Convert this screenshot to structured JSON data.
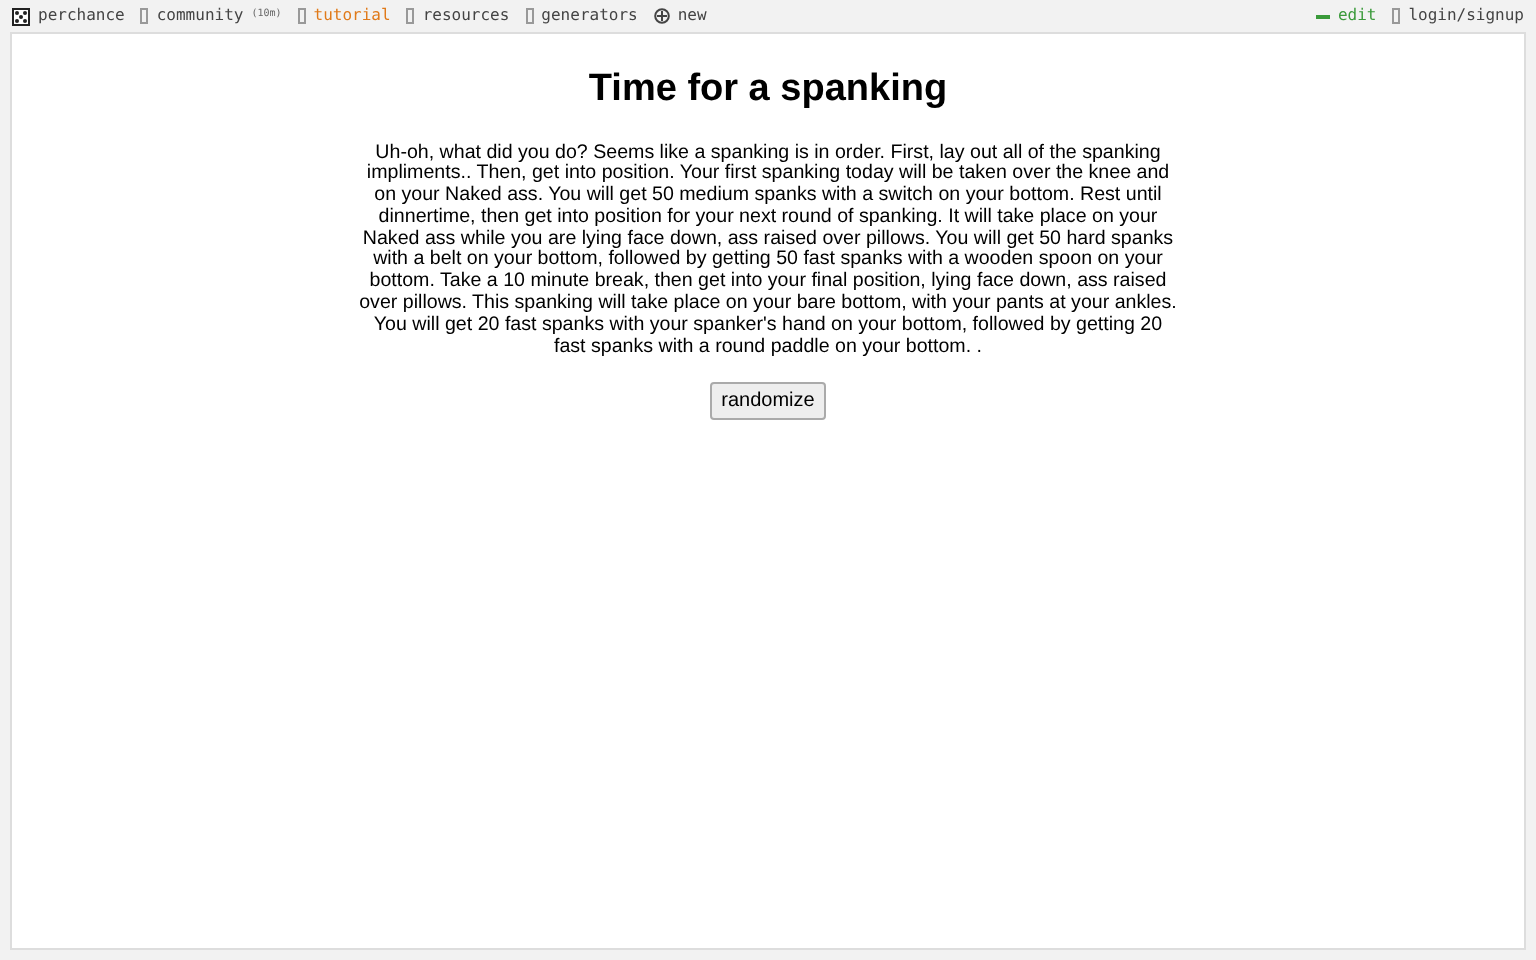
{
  "nav_left": [
    {
      "kind": "logo",
      "label": "perchance",
      "highlight": false
    },
    {
      "kind": "item",
      "label": "community",
      "note": "(10m)",
      "highlight": false
    },
    {
      "kind": "item",
      "label": "tutorial",
      "highlight": true
    },
    {
      "kind": "item",
      "label": "resources",
      "highlight": false
    },
    {
      "kind": "item",
      "label": "generators",
      "highlight": false
    },
    {
      "kind": "plus",
      "label": "new",
      "highlight": false
    }
  ],
  "nav_right": [
    {
      "kind": "edit",
      "label": "edit"
    },
    {
      "kind": "item",
      "label": "login/signup"
    }
  ],
  "title": "Time for a spanking",
  "output": "Uh-oh, what did you do? Seems like a spanking is in order. First, lay out all of the spanking impliments.. Then, get into position. Your first spanking today will be taken over the knee and on your Naked ass. You will get 50 medium spanks with a switch on your bottom. Rest until dinnertime, then get into position for your next round of spanking. It will take place on your Naked ass while you are lying face down, ass raised over pillows. You will get 50 hard spanks with a belt on your bottom, followed by getting 50 fast spanks with a wooden spoon on your bottom. Take a 10 minute break, then get into your final position, lying face down, ass raised over pillows. This spanking will take place on your bare bottom, with your pants at your ankles. You will get 20 fast spanks with your spanker's hand on your bottom, followed by getting 20 fast spanks with a round paddle on your bottom. .",
  "button": "randomize"
}
